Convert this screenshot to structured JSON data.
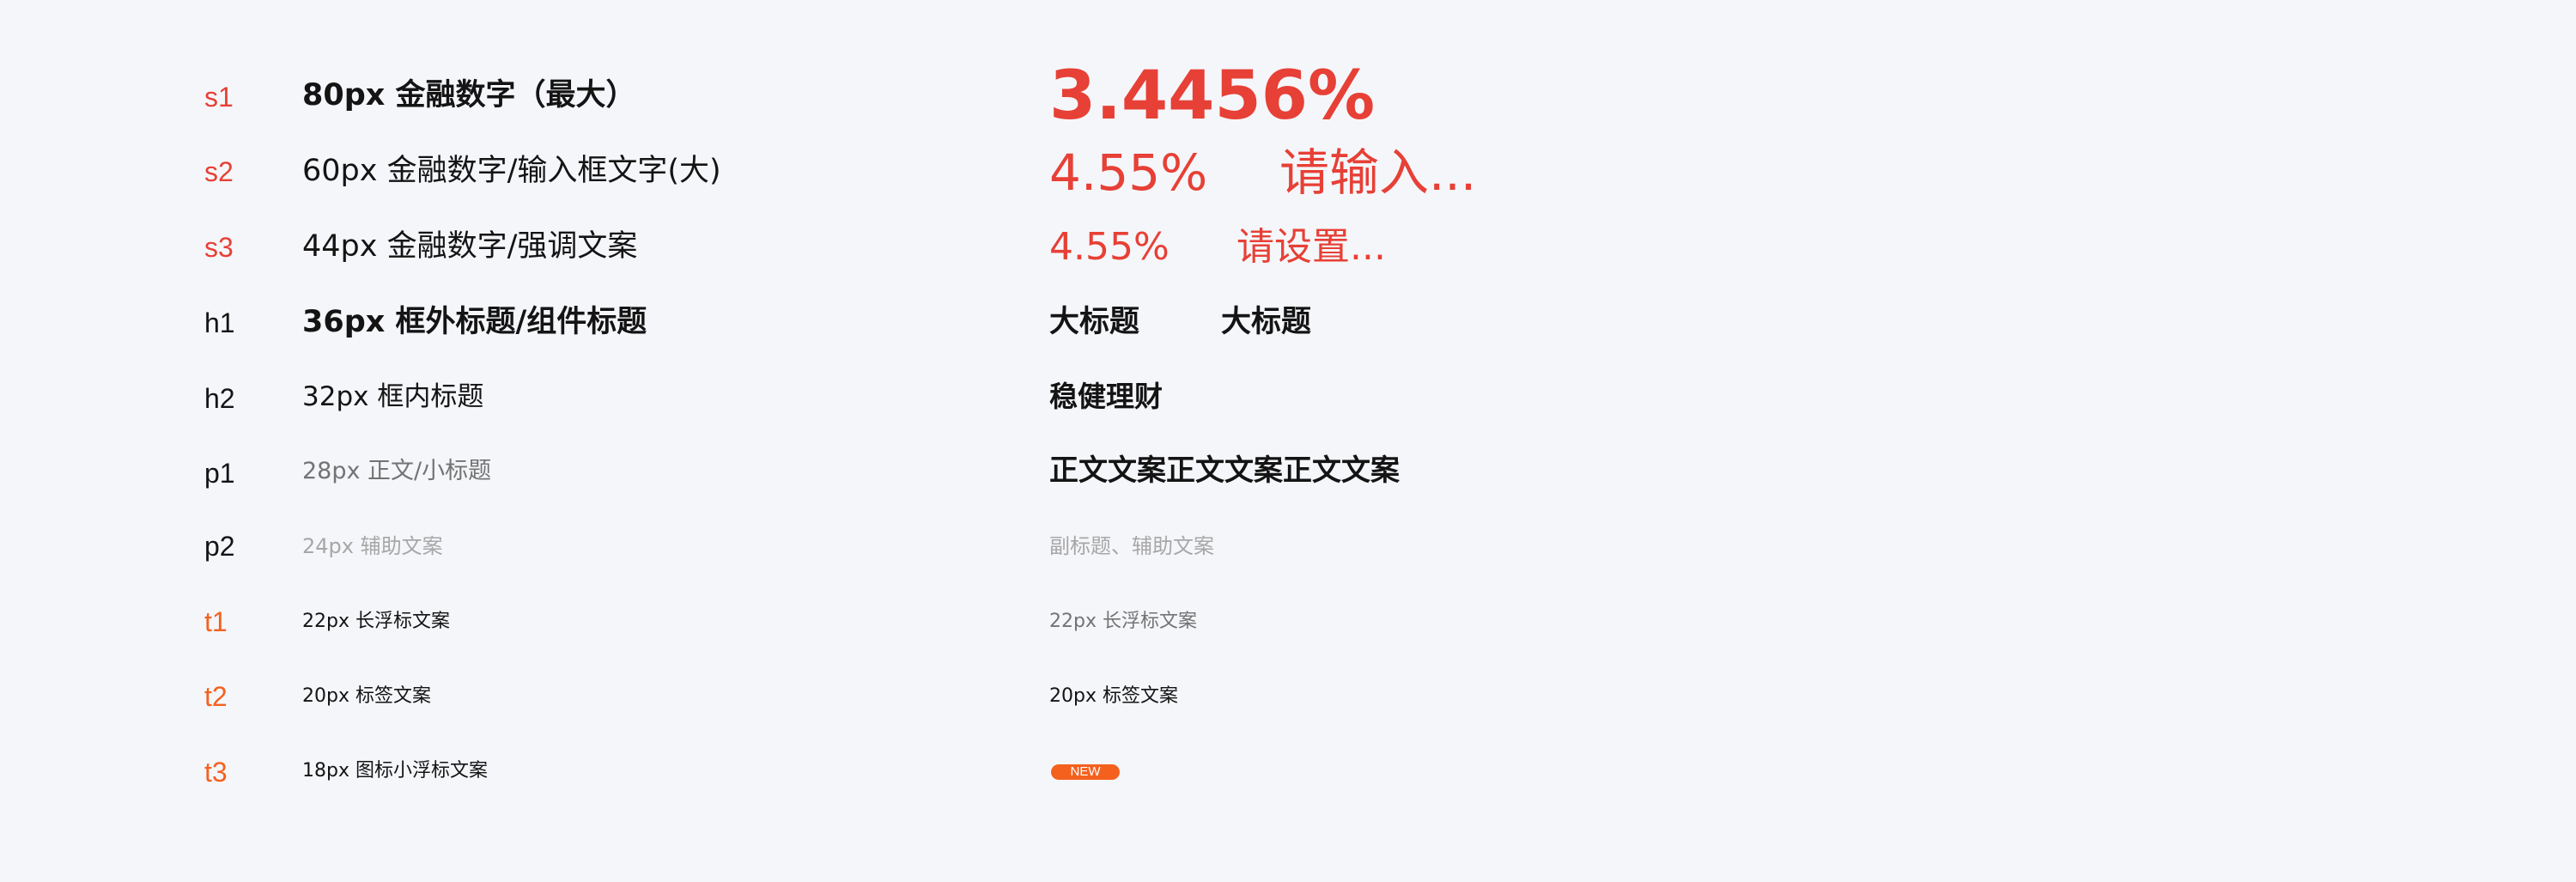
{
  "colors": {
    "background": "#f5f6fa",
    "accent_red": "#e74036",
    "accent_orange": "#f4611f",
    "text_primary": "#141414",
    "text_secondary": "#737373",
    "text_tertiary": "#a7a7a7"
  },
  "rows": [
    {
      "code": "s1",
      "desc": "80px 金融数字（最大）",
      "samples": [
        "3.4456%"
      ]
    },
    {
      "code": "s2",
      "desc": "60px 金融数字/输入框文字(大)",
      "samples": [
        "4.55%",
        "请输入..."
      ]
    },
    {
      "code": "s3",
      "desc": "44px 金融数字/强调文案",
      "samples": [
        "4.55%",
        "请设置..."
      ]
    },
    {
      "code": "h1",
      "desc": "36px 框外标题/组件标题",
      "samples": [
        "大标题",
        "大标题"
      ]
    },
    {
      "code": "h2",
      "desc": "32px 框内标题",
      "samples": [
        "稳健理财"
      ]
    },
    {
      "code": "p1",
      "desc": "28px 正文/小标题",
      "samples": [
        "正文文案正文文案正文文案"
      ]
    },
    {
      "code": "p2",
      "desc": "24px 辅助文案",
      "samples": [
        "副标题、辅助文案"
      ]
    },
    {
      "code": "t1",
      "desc": "22px 长浮标文案",
      "samples": [
        "22px 长浮标文案"
      ]
    },
    {
      "code": "t2",
      "desc": "20px 标签文案",
      "samples": [
        "20px 标签文案"
      ]
    },
    {
      "code": "t3",
      "desc": "18px 图标小浮标文案",
      "samples": [
        "NEW"
      ]
    }
  ]
}
